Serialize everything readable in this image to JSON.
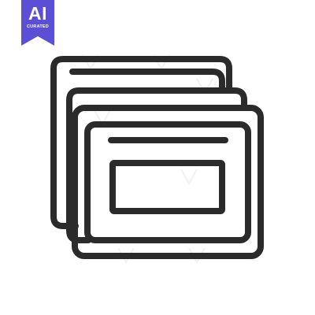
{
  "badge": {
    "main_label": "AI",
    "sub_label": "CURATED",
    "color": "#5b4fd6"
  },
  "icon": {
    "name": "stacked-windows-icon",
    "stroke_color": "#2b2b2b"
  },
  "watermark": {
    "name": "vecteezy-watermark"
  }
}
